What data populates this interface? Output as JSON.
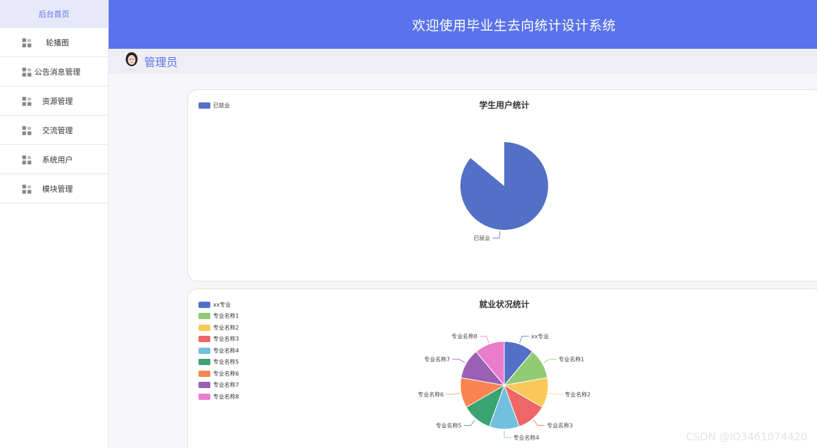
{
  "sidebar": {
    "home": "后台首页",
    "items": [
      {
        "label": "轮播图",
        "icon": "grid-icon"
      },
      {
        "label": "公告消息管理",
        "icon": "grid-icon"
      },
      {
        "label": "资源管理",
        "icon": "grid-icon"
      },
      {
        "label": "交流管理",
        "icon": "grid-icon"
      },
      {
        "label": "系统用户",
        "icon": "grid-icon"
      },
      {
        "label": "模块管理",
        "icon": "grid-icon"
      }
    ]
  },
  "header": {
    "title": "欢迎使用毕业生去向统计设计系统"
  },
  "user": {
    "name": "管理员"
  },
  "watermark": "CSDN @ID3461074420",
  "colors": {
    "accent": "#5a73ec",
    "palette": [
      "#5470c6",
      "#91cc75",
      "#fac858",
      "#ee6666",
      "#73c0de",
      "#3ba272",
      "#fc8452",
      "#9a60b4",
      "#ea7ccc"
    ]
  },
  "chart_data": [
    {
      "type": "pie",
      "title": "学生用户统计",
      "categories": [
        "已就业"
      ],
      "values": [
        1
      ],
      "legend": "top-left"
    },
    {
      "type": "pie",
      "title": "就业状况统计",
      "categories": [
        "xx专业",
        "专业名称1",
        "专业名称2",
        "专业名称3",
        "专业名称4",
        "专业名称5",
        "专业名称6",
        "专业名称7",
        "专业名称8"
      ],
      "values": [
        1,
        1,
        1,
        1,
        1,
        1,
        1,
        1,
        1
      ],
      "legend": "top-left"
    }
  ]
}
